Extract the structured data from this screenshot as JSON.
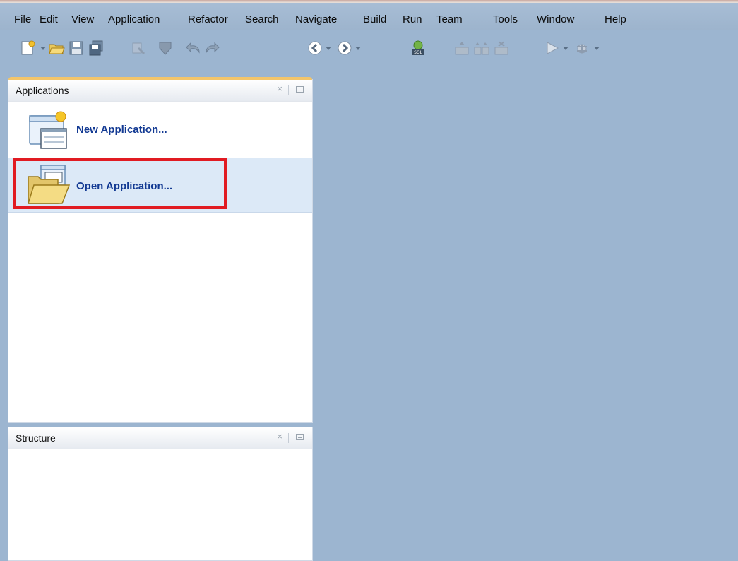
{
  "menu": {
    "items": [
      {
        "label": "File"
      },
      {
        "label": "Edit"
      },
      {
        "label": "View"
      },
      {
        "label": "Application"
      },
      {
        "label": "Refactor"
      },
      {
        "label": "Search"
      },
      {
        "label": "Navigate"
      },
      {
        "label": "Build"
      },
      {
        "label": "Run"
      },
      {
        "label": "Team"
      },
      {
        "label": "Tools"
      },
      {
        "label": "Window"
      },
      {
        "label": "Help"
      }
    ]
  },
  "toolbar": {
    "icons": [
      "new-icon",
      "open-icon",
      "save-icon",
      "save-all-icon",
      "make-icon",
      "rebuild-icon",
      "undo-icon",
      "redo-icon",
      "back-icon",
      "forward-icon",
      "sql-worksheet-icon",
      "deploy-icon",
      "deploy-all-icon",
      "clean-icon",
      "run-icon",
      "debug-icon"
    ]
  },
  "applications_panel": {
    "title": "Applications",
    "close_glyph": "×",
    "actions": [
      {
        "label": "New Application..."
      },
      {
        "label": "Open Application..."
      }
    ]
  },
  "structure_panel": {
    "title": "Structure",
    "close_glyph": "×"
  },
  "colors": {
    "workspace": "#9cb5d0",
    "action_label": "#133a93",
    "highlight_border": "#e11b22",
    "selected_row": "#dce9f7"
  }
}
